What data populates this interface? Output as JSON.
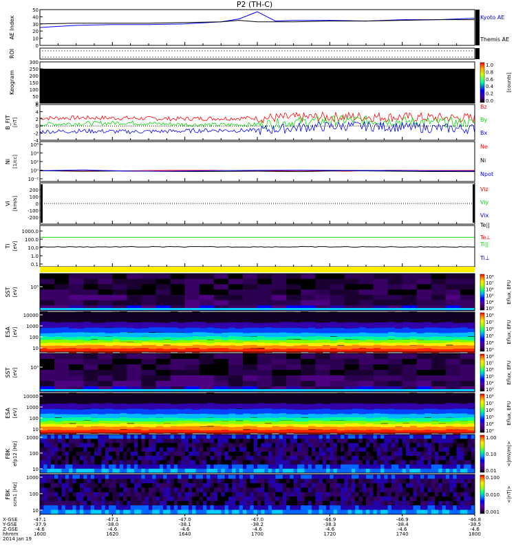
{
  "figure": {
    "title": "P2 (TH-C)",
    "colors": {
      "red": "#ff0000",
      "green": "#00dd00",
      "blue": "#0000ff",
      "black": "#000000",
      "yellow": "#ffee00"
    }
  },
  "chart_data": [
    {
      "type": "line",
      "panel": "ae",
      "ylabel": "AE Index",
      "ylim": [
        0,
        50
      ],
      "ticks": [
        "0",
        "10",
        "20",
        "30",
        "40",
        "50"
      ],
      "legend": [
        "Kyoto AE",
        "Themis AE"
      ],
      "x": [
        1600,
        1610,
        1620,
        1630,
        1640,
        1650,
        1655,
        1700,
        1705,
        1710,
        1720,
        1730,
        1740,
        1750,
        1800
      ],
      "series": [
        {
          "name": "Kyoto AE",
          "color": "#0000ff",
          "values": [
            25,
            28,
            29,
            29,
            30,
            33,
            37,
            47,
            34,
            35,
            35,
            34,
            36,
            36,
            38
          ]
        },
        {
          "name": "Themis AE",
          "color": "#000000",
          "values": [
            30,
            31,
            31,
            31,
            32,
            33,
            35,
            33,
            33,
            33,
            34,
            34,
            35,
            36,
            36
          ]
        }
      ]
    },
    {
      "type": "heatmap",
      "panel": "roi",
      "ylabel": "ROI"
    },
    {
      "type": "heatmap",
      "panel": "keogram",
      "ylabel": "Keogram",
      "ylim": [
        0,
        300
      ],
      "ticks": [
        "0",
        "50",
        "100",
        "150",
        "200",
        "250",
        "300"
      ],
      "colorbar": {
        "ticks": [
          "0.0",
          "0.2",
          "0.4",
          "0.6",
          "0.8",
          "1.0"
        ],
        "label": "[counts]"
      }
    },
    {
      "type": "line",
      "panel": "bfield",
      "ylabel": "B_FIT",
      "ylabel_sub": "[nT]",
      "ylim": [
        -4,
        6
      ],
      "ticks": [
        "-4",
        "-2",
        "0",
        "2",
        "4",
        "6"
      ],
      "legend": [
        "Bz",
        "By",
        "Bx"
      ],
      "x": [
        1600,
        1620,
        1640,
        1660,
        1680,
        1700,
        1720,
        1740,
        1760,
        1780,
        1800
      ],
      "series": [
        {
          "name": "Bz",
          "color": "#ff0000",
          "values": [
            2.2,
            2.3,
            2.2,
            2.0,
            2.1,
            2.2,
            2.4,
            2.6,
            2.5,
            2.3,
            2.2
          ]
        },
        {
          "name": "By",
          "color": "#00dd00",
          "values": [
            0.5,
            0.7,
            0.9,
            0.5,
            0.3,
            0.4,
            1.2,
            1.6,
            1.4,
            1.0,
            0.9
          ]
        },
        {
          "name": "Bx",
          "color": "#0000ff",
          "values": [
            -1.6,
            -1.4,
            -1.6,
            -1.5,
            -1.2,
            -1.3,
            -0.4,
            0.0,
            -0.2,
            -0.6,
            -0.8
          ]
        }
      ]
    },
    {
      "type": "line",
      "panel": "density",
      "ylabel": "Ni",
      "ylabel_sub": "[1/cc]",
      "log": true,
      "ticks": [
        "10⁻²",
        "10⁰",
        "10²",
        "10⁴",
        "10⁶"
      ],
      "legend": [
        "Ne",
        "Ni",
        "Npot"
      ],
      "x": [
        1600,
        1620,
        1640,
        1660,
        1680,
        1700,
        1720,
        1740,
        1760,
        1780,
        1800
      ],
      "series": [
        {
          "name": "Ne",
          "color": "#ff0000",
          "values": [
            0.5,
            0.5,
            0.5,
            0.5,
            0.5,
            0.5,
            0.5,
            0.5,
            0.5,
            0.5,
            0.5
          ]
        },
        {
          "name": "Ni",
          "color": "#000000",
          "values": [
            0.4,
            0.4,
            0.4,
            0.4,
            0.4,
            0.4,
            0.4,
            0.4,
            0.4,
            0.4,
            0.4
          ]
        },
        {
          "name": "Npot",
          "color": "#0000ff",
          "values": [
            0.5,
            0.6,
            0.5,
            0.5,
            0.6,
            0.5,
            0.6,
            0.6,
            0.5,
            0.6,
            0.5
          ]
        }
      ]
    },
    {
      "type": "line",
      "panel": "velocity",
      "ylabel": "Vi",
      "ylabel_sub": "[km/s]",
      "ylim": [
        -300,
        300
      ],
      "ticks": [
        "-200",
        "-100",
        "0",
        "100",
        "200"
      ],
      "legend": [
        "Viz",
        "Viy",
        "Vix"
      ],
      "series": [
        {
          "name": "Viz",
          "color": "#ff0000",
          "values": []
        },
        {
          "name": "Viy",
          "color": "#00dd00",
          "values": []
        },
        {
          "name": "Vix",
          "color": "#0000ff",
          "values": []
        }
      ]
    },
    {
      "type": "line",
      "panel": "temperature",
      "ylabel": "Ti",
      "ylabel_sub": "[eV]",
      "log": true,
      "ticks": [
        "0.1",
        "1.0",
        "10.0",
        "100.0",
        "1000.0"
      ],
      "legend": [
        "Te||",
        "Te⊥",
        "Ti||",
        "Ti⊥"
      ],
      "x": [
        1600,
        1700,
        1800
      ],
      "series": [
        {
          "name": "Te⊥",
          "color": "#00dd00",
          "values": [
            170,
            170,
            170
          ]
        },
        {
          "name": "Te||",
          "color": "#000000",
          "values": [
            12,
            11,
            12
          ]
        }
      ]
    },
    {
      "type": "heatmap",
      "panel": "sst1",
      "ylabel": "SST",
      "ylabel_sub": "[eV]",
      "ticks": [
        "10⁵"
      ],
      "colorbar": {
        "label": "Eflux, EFU",
        "ticks": [
          "10³",
          "10⁴",
          "10⁵",
          "10⁶",
          "10⁷",
          "10⁸"
        ]
      }
    },
    {
      "type": "heatmap",
      "panel": "esa1",
      "ylabel": "ESA",
      "ylabel_sub": "[eV]",
      "ticks": [
        "10",
        "100",
        "1000",
        "10000"
      ],
      "colorbar": {
        "label": "Eflux, EFU",
        "ticks": [
          "10³",
          "10⁴",
          "10⁵",
          "10⁶",
          "10⁷",
          "10⁸"
        ]
      }
    },
    {
      "type": "heatmap",
      "panel": "sst2",
      "ylabel": "SST",
      "ylabel_sub": "[eV]",
      "ticks": [
        "10⁵"
      ],
      "colorbar": {
        "label": "Eflux, EFU",
        "ticks": [
          "10³",
          "10⁴",
          "10⁵",
          "10⁶",
          "10⁷",
          "10⁸"
        ]
      }
    },
    {
      "type": "heatmap",
      "panel": "esa2",
      "ylabel": "ESA",
      "ylabel_sub": "[eV]",
      "ticks": [
        "10",
        "100",
        "1000",
        "10000"
      ],
      "colorbar": {
        "label": "Eflux, EFU",
        "ticks": [
          "10³",
          "10⁴",
          "10⁵",
          "10⁶",
          "10⁷",
          "10⁸"
        ]
      }
    },
    {
      "type": "heatmap",
      "panel": "fbk1",
      "ylabel": "FBK",
      "ylabel_sub": "efp12 [Hz]",
      "ticks": [
        "10",
        "100",
        "1000"
      ],
      "colorbar": {
        "label": "<|mV/m|>",
        "ticks": [
          "0.01",
          "0.10",
          "1.00"
        ]
      }
    },
    {
      "type": "heatmap",
      "panel": "fbk2",
      "ylabel": "FBK",
      "ylabel_sub": "scm1 [Hz]",
      "ticks": [
        "10",
        "100",
        "1000"
      ],
      "colorbar": {
        "label": "<|nT|>",
        "ticks": [
          "0.001",
          "0.010",
          "0.100"
        ]
      }
    }
  ],
  "x_axis": {
    "row_labels": [
      "X-GSE",
      "Y-GSE",
      "Z-GSE",
      "hhmm"
    ],
    "date": "2014 Jan 19",
    "ticks": [
      {
        "x": "-47.1",
        "y": "-37.9",
        "z": "-4.6",
        "t": "1600"
      },
      {
        "x": "-47.1",
        "y": "-38.0",
        "z": "-4.6",
        "t": "1620"
      },
      {
        "x": "-47.0",
        "y": "-38.1",
        "z": "-4.6",
        "t": "1640"
      },
      {
        "x": "-47.0",
        "y": "-38.2",
        "z": "-4.6",
        "t": "1700"
      },
      {
        "x": "-46.9",
        "y": "-38.3",
        "z": "-4.6",
        "t": "1720"
      },
      {
        "x": "-46.9",
        "y": "-38.4",
        "z": "-4.6",
        "t": "1740"
      },
      {
        "x": "-46.8",
        "y": "-38.5",
        "z": "-4.6",
        "t": "1800"
      }
    ]
  }
}
